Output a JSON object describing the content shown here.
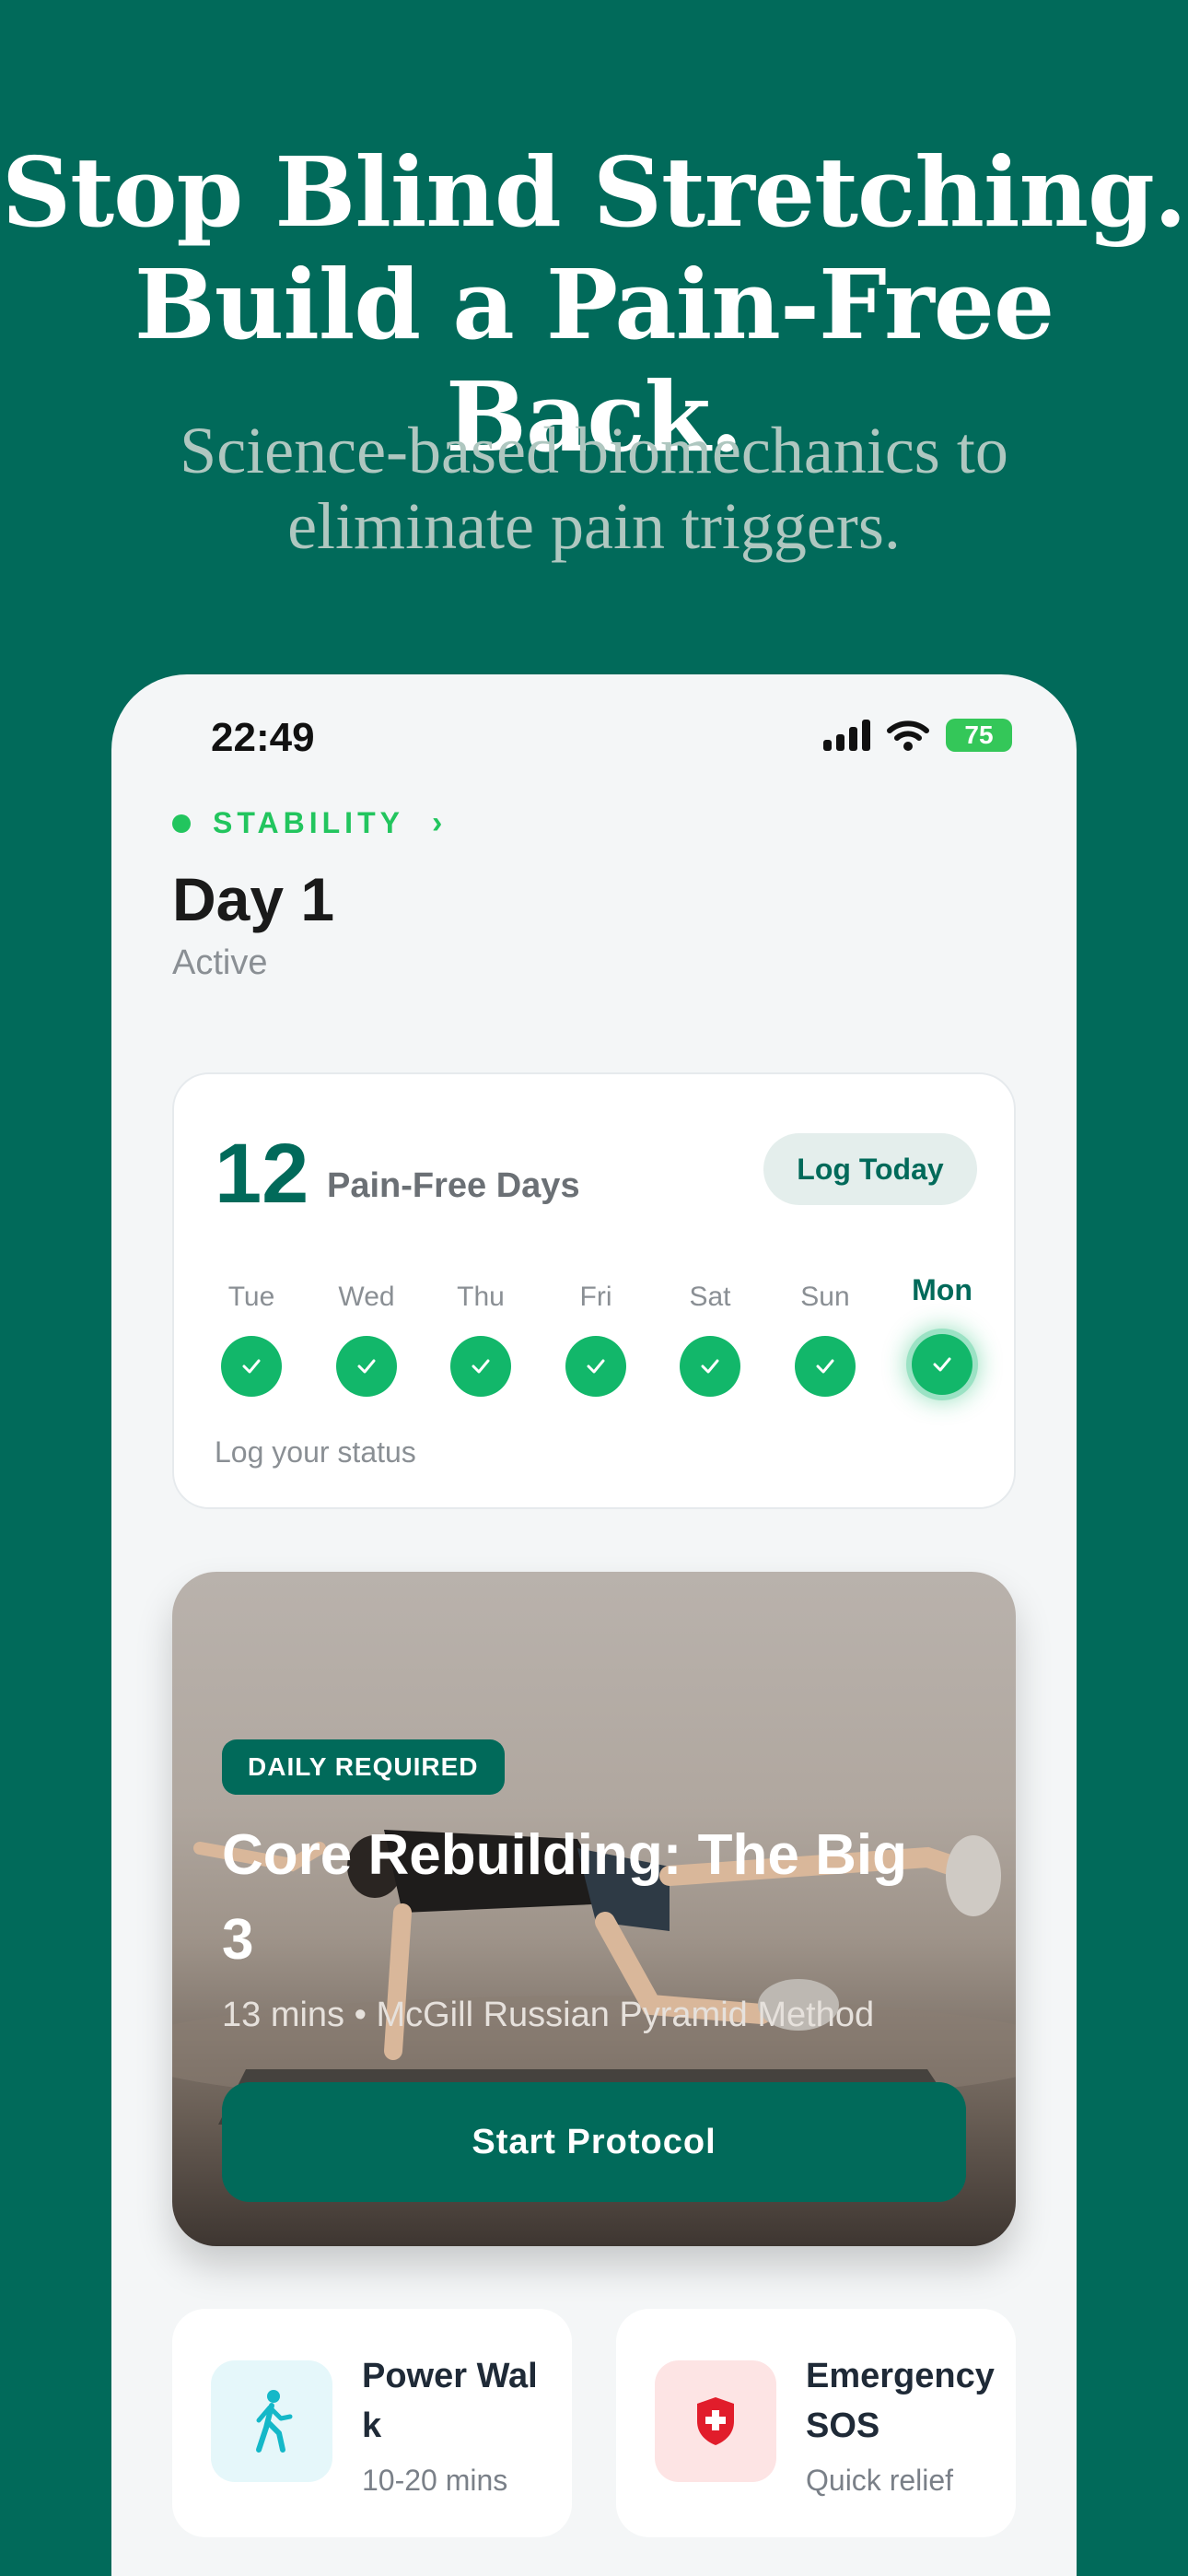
{
  "headline": {
    "line1": "Stop Blind Stretching.",
    "line2": "Build a Pain-Free Back."
  },
  "subhead": {
    "line1": "Science-based biomechanics to",
    "line2": "eliminate pain triggers."
  },
  "status_bar": {
    "time": "22:49",
    "battery": "75"
  },
  "program": {
    "label": "STABILITY",
    "day_title": "Day 1",
    "day_status": "Active"
  },
  "streak": {
    "count": "12",
    "label": "Pain-Free Days",
    "log_button": "Log Today",
    "days": [
      "Tue",
      "Wed",
      "Thu",
      "Fri",
      "Sat",
      "Sun",
      "Mon"
    ],
    "current_day": "Mon",
    "footer": "Log your status"
  },
  "workout": {
    "badge": "DAILY REQUIRED",
    "title": "Core Rebuilding: The Big 3",
    "meta": "13 mins • McGill Russian Pyramid Method",
    "start_button": "Start Protocol"
  },
  "quick_actions": [
    {
      "title": "Power Walk",
      "subtitle": "10-20 mins",
      "icon": "walking-person-icon"
    },
    {
      "title": "Emergency SOS",
      "subtitle": "Quick relief",
      "icon": "medical-shield-icon"
    }
  ],
  "colors": {
    "brand": "#016A5A",
    "success": "#12B76A",
    "accent_green": "#22C55E",
    "sos_red": "#E11D2B",
    "walk_cyan": "#14B8C8"
  }
}
